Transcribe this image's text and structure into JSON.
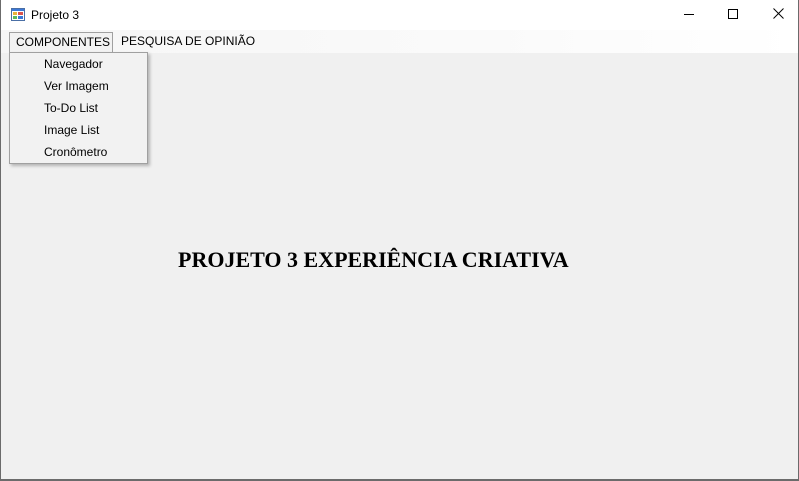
{
  "window": {
    "title": "Projeto 3",
    "icons": {
      "app": "windows-form-icon",
      "minimize": "minimize-icon",
      "maximize": "maximize-icon",
      "close": "close-icon"
    }
  },
  "menubar": {
    "items": [
      {
        "label": "COMPONENTES"
      },
      {
        "label": "PESQUISA DE OPINIÃO"
      }
    ]
  },
  "dropdown": {
    "items": [
      {
        "label": "Navegador"
      },
      {
        "label": "Ver Imagem"
      },
      {
        "label": "To-Do List"
      },
      {
        "label": "Image List"
      },
      {
        "label": "Cronômetro"
      }
    ]
  },
  "main": {
    "heading": "PROJETO 3 EXPERIÊNCIA CRIATIVA"
  },
  "colors": {
    "client_background": "#f0f0f0",
    "titlebar_background": "#ffffff",
    "menu_border": "#a0a0a0"
  }
}
